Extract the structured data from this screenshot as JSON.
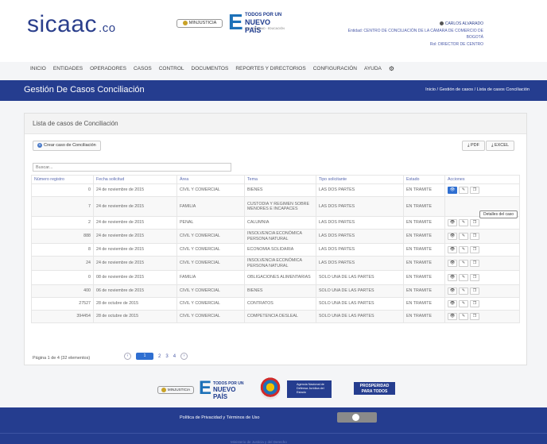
{
  "header": {
    "logo_main": "sicaac",
    "logo_suffix": ".co",
    "gov_logo": "MINJUSTICIA",
    "campaign": {
      "line1": "TODOS POR UN",
      "line2": "NUEVO PAÍS",
      "line3": "PAZ · EQUIDAD · EDUCACIÓN"
    },
    "user": {
      "name": "CARLOS ALVARADO",
      "entity": "Entidad: CENTRO DE CONCILIACIÓN DE LA CÁMARA DE COMERCIO DE",
      "city": "BOGOTÁ",
      "role": "Rol: DIRECTOR DE CENTRO"
    }
  },
  "nav": {
    "items": [
      "INICIO",
      "ENTIDADES",
      "OPERADORES",
      "CASOS",
      "CONTROL",
      "DOCUMENTOS",
      "REPORTES Y DIRECTORIOS",
      "CONFIGURACIÓN",
      "AYUDA"
    ],
    "extra_icon": "gear-icon"
  },
  "titlebar": {
    "title": "Gestión De Casos Conciliación",
    "breadcrumb": "Inicio / Gestión de casos / Lista de casos Conciliación"
  },
  "panel": {
    "heading": "Lista de casos de Conciliación",
    "new_button": "Crear caso de Conciliación",
    "pdf_button": "PDF",
    "excel_button": "EXCEL",
    "search_placeholder": "Buscar..."
  },
  "table": {
    "headers": [
      "Número registro",
      "Fecha solicitud",
      "Área",
      "Tema",
      "Tipo solicitante",
      "Estado",
      "Acciones"
    ],
    "rows": [
      [
        "0",
        "24 de noviembre de 2015",
        "CIVIL Y COMERCIAL",
        "BIENES",
        "LAS DOS PARTES",
        "EN TRAMITE"
      ],
      [
        "7",
        "24 de noviembre de 2015",
        "FAMILIA",
        "CUSTODIA Y REGIMEN SOBRE MENORES E INCAPACES",
        "LAS DOS PARTES",
        "EN TRAMITE"
      ],
      [
        "2",
        "24 de noviembre de 2015",
        "PENAL",
        "CALUMNIA",
        "LAS DOS PARTES",
        "EN TRAMITE"
      ],
      [
        "888",
        "24 de noviembre de 2015",
        "CIVIL Y COMERCIAL",
        "INSOLVENCIA ECONÓMICA PERSONA NATURAL",
        "LAS DOS PARTES",
        "EN TRAMITE"
      ],
      [
        "8",
        "24 de noviembre de 2015",
        "CIVIL Y COMERCIAL",
        "ECONOMIA SOLIDARIA",
        "LAS DOS PARTES",
        "EN TRAMITE"
      ],
      [
        "24",
        "24 de noviembre de 2015",
        "CIVIL Y COMERCIAL",
        "INSOLVENCIA ECONÓMICA PERSONA NATURAL",
        "LAS DOS PARTES",
        "EN TRAMITE"
      ],
      [
        "0",
        "08 de noviembre de 2015",
        "FAMILIA",
        "OBLIGACIONES ALIMENTARIAS",
        "SOLO UNA DE LAS PARTES",
        "EN TRAMITE"
      ],
      [
        "400",
        "06 de noviembre de 2015",
        "CIVIL Y COMERCIAL",
        "BIENES",
        "SOLO UNA DE LAS PARTES",
        "EN TRAMITE"
      ],
      [
        "27527",
        "28 de octubre de 2015",
        "CIVIL Y COMERCIAL",
        "CONTRATOS",
        "SOLO UNA DE LAS PARTES",
        "EN TRAMITE"
      ],
      [
        "394454",
        "28 de octubre de 2015",
        "CIVIL Y COMERCIAL",
        "COMPETENCIA DESLEAL",
        "SOLO UNA DE LAS PARTES",
        "EN TRAMITE"
      ]
    ],
    "tooltip": "Detalles del caso"
  },
  "pagination": {
    "info": "Página 1 de 4 (32 elementos)",
    "pages": [
      "1",
      "2",
      "3",
      "4"
    ]
  },
  "footer_logos": {
    "gov": "MINJUSTICIA",
    "campaign1": "TODOS POR UN",
    "campaign2": "NUEVO PAÍS",
    "agency": "Agencia Nacional de Defensa Jurídica del Estado",
    "prosperity1": "PROSPERIDAD",
    "prosperity2": "PARA TODOS"
  },
  "footer": {
    "policy": "Política de Privacidad y Términos de Uso",
    "copyright": "Ministerio de Justicia y del Derecho"
  }
}
